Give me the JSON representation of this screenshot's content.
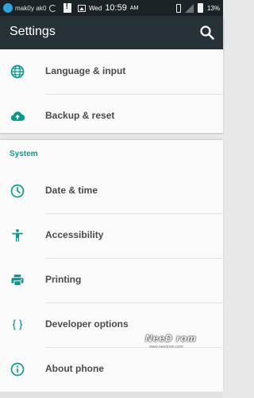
{
  "status_bar": {
    "carrier": "mak0y ak0",
    "day": "Wed",
    "time": "10:59",
    "ampm": "AM",
    "battery": "13%"
  },
  "app_bar": {
    "title": "Settings"
  },
  "top_items": [
    {
      "label": "Language & input",
      "icon": "globe-icon"
    },
    {
      "label": "Backup & reset",
      "icon": "cloud-upload-icon"
    }
  ],
  "system": {
    "header": "System",
    "items": [
      {
        "label": "Date & time",
        "icon": "clock-icon"
      },
      {
        "label": "Accessibility",
        "icon": "accessibility-icon"
      },
      {
        "label": "Printing",
        "icon": "printer-icon"
      },
      {
        "label": "Developer options",
        "icon": "braces-icon"
      },
      {
        "label": "About phone",
        "icon": "info-icon"
      }
    ]
  },
  "watermark": {
    "logo": "NeeD rom",
    "url": "www.needrom.com"
  },
  "colors": {
    "accent": "#0a9a8d",
    "app_bar": "#263238",
    "status_bar": "#1c2326",
    "text": "#4a4a4a"
  }
}
